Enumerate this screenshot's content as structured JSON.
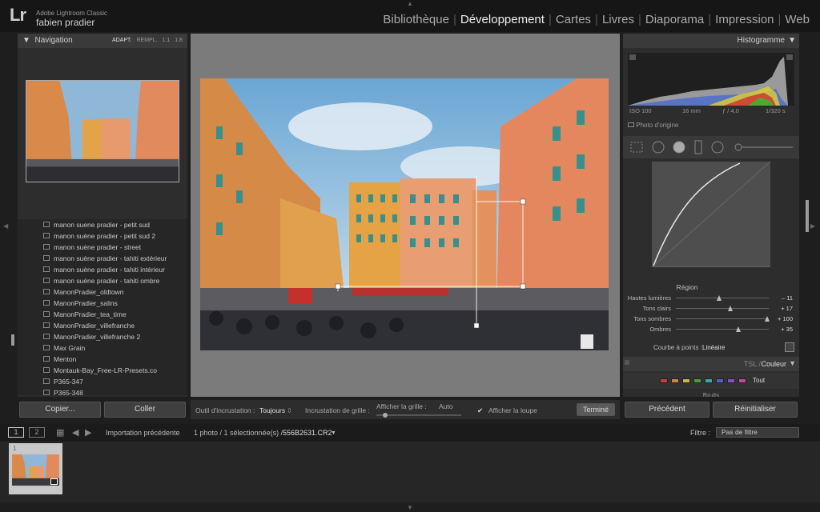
{
  "app": {
    "logo": "Lr",
    "name": "Adobe Lightroom Classic",
    "user": "fabien pradier"
  },
  "modules": [
    "Bibliothèque",
    "Développement",
    "Cartes",
    "Livres",
    "Diaporama",
    "Impression",
    "Web"
  ],
  "active_module": "Développement",
  "navigator": {
    "title": "Navigation",
    "opts": [
      "ADAPT.",
      "REMPL.",
      "1:1",
      "1:8"
    ]
  },
  "collections": [
    "manon suene pradier - petit sud",
    "manon suène pradier - petit sud 2",
    "manon suène pradier - street",
    "manon suène pradier - tahiti extérieur",
    "manon suène pradier - tahiti intérieur",
    "manon suène pradier - tahiti ombre",
    "ManonPradier_oldtown",
    "ManonPradier_salins",
    "ManonPradier_tea_time",
    "ManonPradier_villefranche",
    "ManonPradier_villefranche 2",
    "Max Grain",
    "Menton",
    "Montauk-Bay_Free-LR-Presets.co",
    "P365-347",
    "P365-348"
  ],
  "left_buttons": {
    "copy": "Copier...",
    "paste": "Coller"
  },
  "toolbar": {
    "overlay_tool_label": "Outil d'incrustation :",
    "overlay_tool_value": "Toujours",
    "grid_overlay_label": "Incrustation de grille :",
    "show_grid_label": "Afficher la grille :",
    "show_grid_value": "Auto",
    "show_loupe_label": "Afficher la loupe",
    "done_label": "Terminé"
  },
  "histogram": {
    "title": "Histogramme",
    "iso": "ISO 100",
    "focal": "16 mm",
    "aperture": "ƒ / 4,0",
    "shutter": "1/320 s",
    "original_photo": "Photo d'origine"
  },
  "tone_curve": {
    "region_title": "Région",
    "sliders": [
      {
        "label": "Hautes lumières",
        "value": "– 11",
        "pos": -11
      },
      {
        "label": "Tons clairs",
        "value": "+ 17",
        "pos": 17
      },
      {
        "label": "Tons sombres",
        "value": "+ 100",
        "pos": 100
      },
      {
        "label": "Ombres",
        "value": "+ 35",
        "pos": 35
      }
    ],
    "point_curve_label": "Courbe à points :",
    "point_curve_value": "Linéaire"
  },
  "hsl": {
    "title_tsl": "TSL /",
    "title_color": "Couleur",
    "all_label": "Tout",
    "swatches": [
      "#c63b3b",
      "#c98a32",
      "#c8b83a",
      "#4a9a48",
      "#3fa6a0",
      "#4a62c2",
      "#8a4fc0",
      "#c04aa0"
    ],
    "next_panel": "Bruits"
  },
  "right_buttons": {
    "previous": "Précédent",
    "reset": "Réinitialiser"
  },
  "filmbar": {
    "screen1": "1",
    "screen2": "2",
    "source": "Importation précédente",
    "count": "1 photo / 1 sélectionnée(s) /",
    "filename": "556B2631.CR2",
    "filter_label": "Filtre :",
    "filter_value": "Pas de filtre"
  },
  "filmstrip": {
    "index": "1"
  }
}
